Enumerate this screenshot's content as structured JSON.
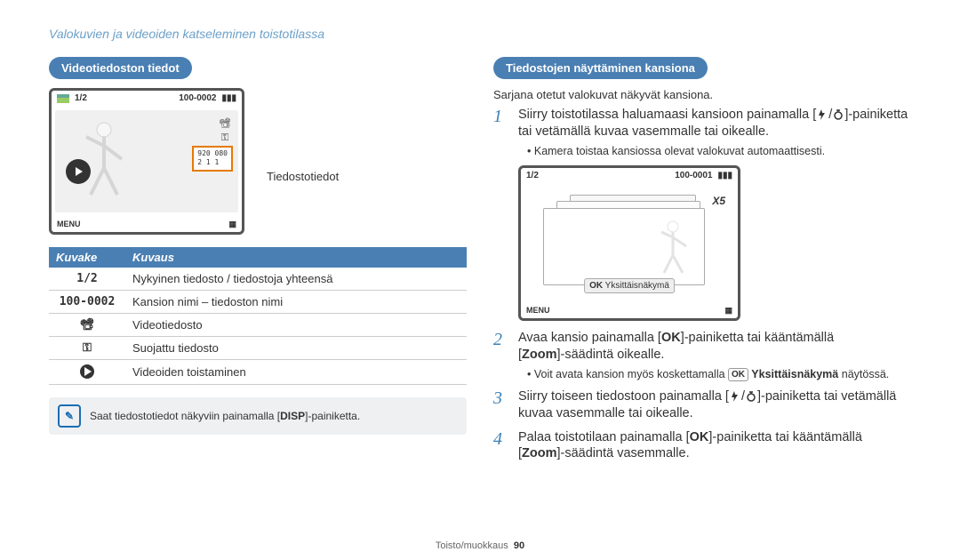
{
  "breadcrumb": "Valokuvien ja videoiden katseleminen toistotilassa",
  "left": {
    "heading": "Videotiedoston tiedot",
    "screenshot": {
      "counter": "1/2",
      "file_id": "100-0002",
      "menu_label": "MENU",
      "info_line1": "920  080",
      "info_line2": "  2 1   1"
    },
    "leader_label": "Tiedostotiedot",
    "table": {
      "h1": "Kuvake",
      "h2": "Kuvaus",
      "rows": [
        {
          "icon": "1/2",
          "desc": "Nykyinen tiedosto / tiedostoja yhteensä"
        },
        {
          "icon": "100-0002",
          "desc": "Kansion nimi – tiedoston nimi"
        },
        {
          "icon": "video",
          "desc": "Videotiedosto"
        },
        {
          "icon": "lock",
          "desc": "Suojattu tiedosto"
        },
        {
          "icon": "play",
          "desc": "Videoiden toistaminen"
        }
      ]
    },
    "note": "Saat tiedostotiedot näkyviin painamalla [DISP]-painiketta."
  },
  "right": {
    "heading": "Tiedostojen näyttäminen kansiona",
    "intro": "Sarjana otetut valokuvat näkyvät kansiona.",
    "step1": {
      "text_a": "Siirry toistotilassa haluamaasi kansioon painamalla [",
      "text_b": "]-painiketta tai vetämällä kuvaa vasemmalle tai oikealle.",
      "bullet": "Kamera toistaa kansiossa olevat valokuvat automaattisesti."
    },
    "screenshot": {
      "counter": "1/2",
      "file_id": "100-0001",
      "menu_label": "MENU",
      "x5": "X5",
      "ok_label": "Yksittäisnäkymä"
    },
    "step2": {
      "text": "Avaa kansio painamalla [OK]-painiketta tai kääntämällä [Zoom]-säädintä oikealle.",
      "bullet_a": "Voit avata kansion myös koskettamalla ",
      "bullet_b": " Yksittäisnäkymä",
      "bullet_c": " näytössä."
    },
    "step3": "Siirry toiseen tiedostoon painamalla [ / ]-painiketta tai vetämällä kuvaa vasemmalle tai oikealle.",
    "step4": "Palaa toistotilaan painamalla [OK]-painiketta tai kääntämällä [Zoom]-säädintä vasemmalle."
  },
  "footer": {
    "section": "Toisto/muokkaus",
    "page": "90"
  }
}
